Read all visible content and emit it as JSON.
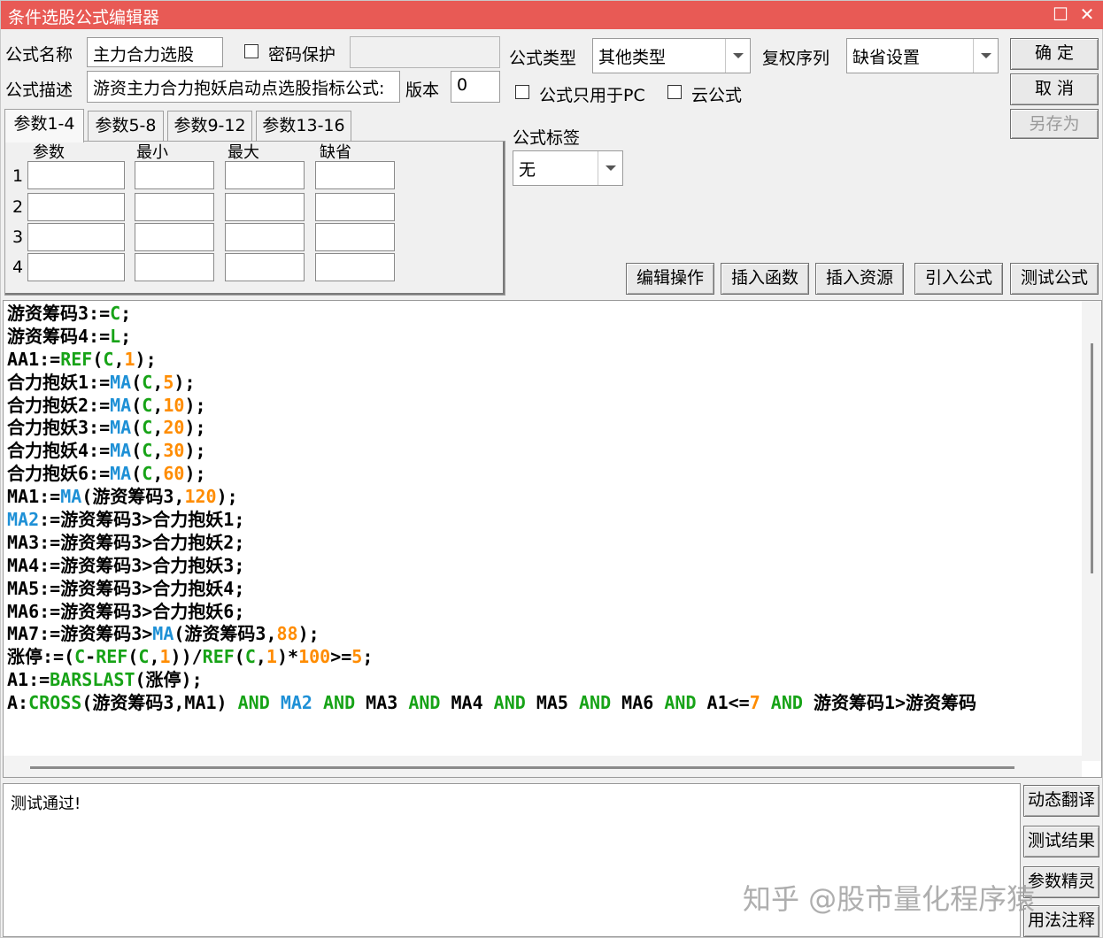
{
  "window": {
    "title": "条件选股公式编辑器",
    "restore_glyph": "☐",
    "close_glyph": "✕",
    "accent": "#e85a55"
  },
  "form": {
    "name_label": "公式名称",
    "name_value": "主力合力选股",
    "password_label": "密码保护",
    "password_value": "",
    "desc_label": "公式描述",
    "desc_value": "游资主力合力抱妖启动点选股指标公式:",
    "version_label": "版本",
    "version_value": "0",
    "type_label": "公式类型",
    "type_value": "其他类型",
    "fuquan_label": "复权序列",
    "fuquan_value": "缺省设置",
    "pc_only_label": "公式只用于PC",
    "cloud_label": "云公式",
    "tag_label": "公式标签",
    "tag_value": "无"
  },
  "buttons": {
    "ok": "确  定",
    "cancel": "取  消",
    "save_as": "另存为",
    "edit_ops": "编辑操作",
    "insert_func": "插入函数",
    "insert_res": "插入资源",
    "import_formula": "引入公式",
    "test_formula": "测试公式",
    "dyn_translate": "动态翻译",
    "test_result": "测试结果",
    "param_wizard": "参数精灵",
    "usage_notes": "用法注释"
  },
  "tabs": [
    "参数1-4",
    "参数5-8",
    "参数9-12",
    "参数13-16"
  ],
  "params": {
    "headers": [
      "参数",
      "最小",
      "最大",
      "缺省"
    ],
    "rows": [
      "1",
      "2",
      "3",
      "4"
    ]
  },
  "code_lines": [
    [
      [
        "k",
        "游资筹码3:="
      ],
      [
        "g",
        "C"
      ],
      [
        "k",
        ";"
      ]
    ],
    [
      [
        "k",
        "游资筹码4:="
      ],
      [
        "g",
        "L"
      ],
      [
        "k",
        ";"
      ]
    ],
    [
      [
        "k",
        "AA1:="
      ],
      [
        "g",
        "REF"
      ],
      [
        "k",
        "("
      ],
      [
        "g",
        "C"
      ],
      [
        "k",
        ","
      ],
      [
        "o",
        "1"
      ],
      [
        "k",
        ");"
      ]
    ],
    [
      [
        "k",
        "合力抱妖1:="
      ],
      [
        "b",
        "MA"
      ],
      [
        "k",
        "("
      ],
      [
        "g",
        "C"
      ],
      [
        "k",
        ","
      ],
      [
        "o",
        "5"
      ],
      [
        "k",
        ");"
      ]
    ],
    [
      [
        "k",
        "合力抱妖2:="
      ],
      [
        "b",
        "MA"
      ],
      [
        "k",
        "("
      ],
      [
        "g",
        "C"
      ],
      [
        "k",
        ","
      ],
      [
        "o",
        "10"
      ],
      [
        "k",
        ");"
      ]
    ],
    [
      [
        "k",
        "合力抱妖3:="
      ],
      [
        "b",
        "MA"
      ],
      [
        "k",
        "("
      ],
      [
        "g",
        "C"
      ],
      [
        "k",
        ","
      ],
      [
        "o",
        "20"
      ],
      [
        "k",
        ");"
      ]
    ],
    [
      [
        "k",
        "合力抱妖4:="
      ],
      [
        "b",
        "MA"
      ],
      [
        "k",
        "("
      ],
      [
        "g",
        "C"
      ],
      [
        "k",
        ","
      ],
      [
        "o",
        "30"
      ],
      [
        "k",
        ");"
      ]
    ],
    [
      [
        "k",
        "合力抱妖6:="
      ],
      [
        "b",
        "MA"
      ],
      [
        "k",
        "("
      ],
      [
        "g",
        "C"
      ],
      [
        "k",
        ","
      ],
      [
        "o",
        "60"
      ],
      [
        "k",
        ");"
      ]
    ],
    [
      [
        "k",
        "MA1:="
      ],
      [
        "b",
        "MA"
      ],
      [
        "k",
        "(游资筹码3,"
      ],
      [
        "o",
        "120"
      ],
      [
        "k",
        ");"
      ]
    ],
    [
      [
        "b",
        "MA2"
      ],
      [
        "k",
        ":=游资筹码3>合力抱妖1;"
      ]
    ],
    [
      [
        "k",
        "MA3:=游资筹码3>合力抱妖2;"
      ]
    ],
    [
      [
        "k",
        "MA4:=游资筹码3>合力抱妖3;"
      ]
    ],
    [
      [
        "k",
        "MA5:=游资筹码3>合力抱妖4;"
      ]
    ],
    [
      [
        "k",
        "MA6:=游资筹码3>合力抱妖6;"
      ]
    ],
    [
      [
        "k",
        "MA7:=游资筹码3>"
      ],
      [
        "b",
        "MA"
      ],
      [
        "k",
        "(游资筹码3,"
      ],
      [
        "o",
        "88"
      ],
      [
        "k",
        ");"
      ]
    ],
    [
      [
        "k",
        "涨停:=("
      ],
      [
        "g",
        "C"
      ],
      [
        "k",
        "-"
      ],
      [
        "g",
        "REF"
      ],
      [
        "k",
        "("
      ],
      [
        "g",
        "C"
      ],
      [
        "k",
        ","
      ],
      [
        "o",
        "1"
      ],
      [
        "k",
        "))/"
      ],
      [
        "g",
        "REF"
      ],
      [
        "k",
        "("
      ],
      [
        "g",
        "C"
      ],
      [
        "k",
        ","
      ],
      [
        "o",
        "1"
      ],
      [
        "k",
        ")*"
      ],
      [
        "o",
        "100"
      ],
      [
        "k",
        ">="
      ],
      [
        "o",
        "5"
      ],
      [
        "k",
        ";"
      ]
    ],
    [
      [
        "k",
        "A1:="
      ],
      [
        "g",
        "BARSLAST"
      ],
      [
        "k",
        "(涨停);"
      ]
    ],
    [
      [
        "k",
        "A:"
      ],
      [
        "g",
        "CROSS"
      ],
      [
        "k",
        "(游资筹码3,MA1) "
      ],
      [
        "g",
        "AND"
      ],
      [
        "k",
        " "
      ],
      [
        "b",
        "MA2"
      ],
      [
        "k",
        " "
      ],
      [
        "g",
        "AND"
      ],
      [
        "k",
        " MA3 "
      ],
      [
        "g",
        "AND"
      ],
      [
        "k",
        " MA4 "
      ],
      [
        "g",
        "AND"
      ],
      [
        "k",
        " MA5 "
      ],
      [
        "g",
        "AND"
      ],
      [
        "k",
        " MA6 "
      ],
      [
        "g",
        "AND"
      ],
      [
        "k",
        " A1<="
      ],
      [
        "o",
        "7"
      ],
      [
        "k",
        " "
      ],
      [
        "g",
        "AND"
      ],
      [
        "k",
        " 游资筹码1>游资筹码"
      ]
    ]
  ],
  "output_text": "测试通过!",
  "watermark": "知乎 @股市量化程序猿"
}
